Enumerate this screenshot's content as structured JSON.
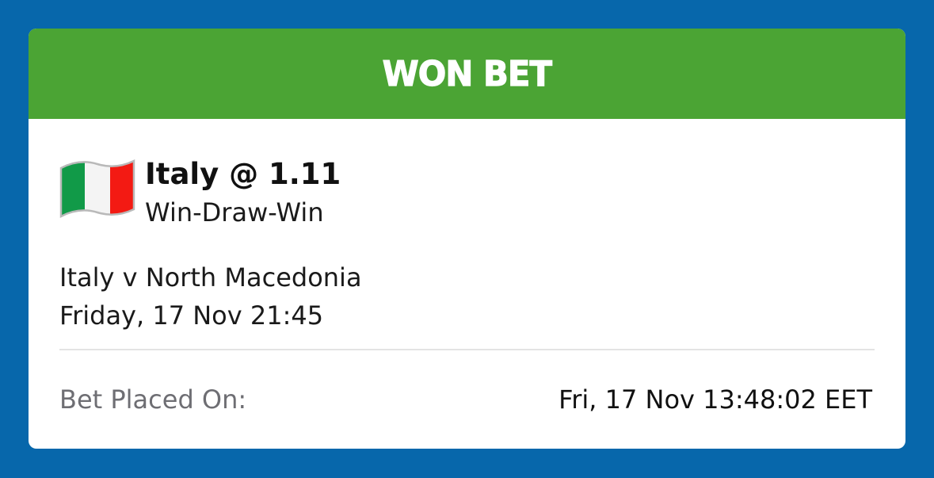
{
  "colors": {
    "background": "#0767ab",
    "banner": "#4ba434",
    "card": "#ffffff",
    "flag_green": "#119a48",
    "flag_white": "#f4f4f4",
    "flag_red": "#f31a13"
  },
  "banner": {
    "title": "WON BET"
  },
  "selection": {
    "flag_icon": "italy-flag-icon",
    "name": "Italy @ 1.11",
    "market": "Win-Draw-Win"
  },
  "event": {
    "match": "Italy v North Macedonia",
    "datetime": "Friday, 17 Nov 21:45"
  },
  "bet_placed": {
    "label": "Bet Placed On:",
    "value": "Fri, 17 Nov 13:48:02 EET"
  }
}
